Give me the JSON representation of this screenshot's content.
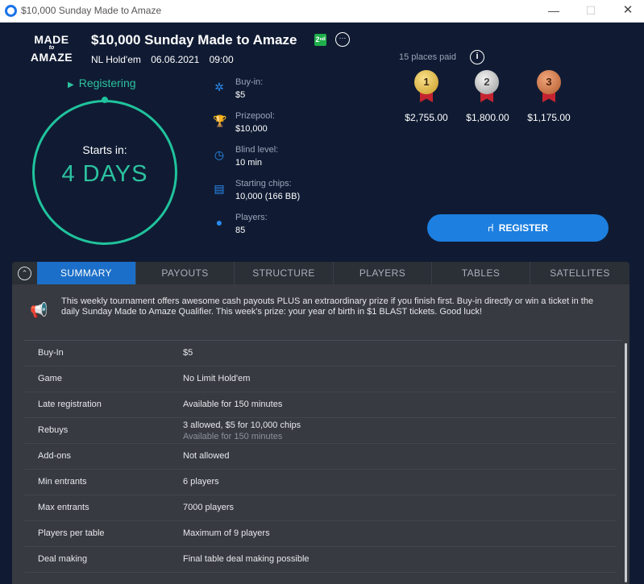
{
  "window": {
    "title": "$10,000 Sunday Made to Amaze",
    "min": "—",
    "max": "☐",
    "close": "✕"
  },
  "logo": {
    "line1": "MADE",
    "line2": "to",
    "line3": "AMAZE"
  },
  "tournament": {
    "name": "$10,000 Sunday Made to Amaze",
    "badge": "2ⁿᵈ",
    "more": "···",
    "game": "NL Hold'em",
    "date": "06.06.2021",
    "time": "09:00"
  },
  "status": {
    "arrow": "▶",
    "label": "Registering",
    "starts_label": "Starts in:",
    "starts_value": "4 DAYS"
  },
  "info": [
    {
      "icon": "poker-chip-icon",
      "glyph": "✲",
      "label": "Buy-in:",
      "value": "$5"
    },
    {
      "icon": "trophy-icon",
      "glyph": "🏆",
      "label": "Prizepool:",
      "value": "$10,000"
    },
    {
      "icon": "clock-icon",
      "glyph": "◷",
      "label": "Blind level:",
      "value": "10 min"
    },
    {
      "icon": "chips-stack-icon",
      "glyph": "▤",
      "label": "Starting chips:",
      "value": "10,000 (166 BB)"
    },
    {
      "icon": "player-icon",
      "glyph": "●",
      "label": "Players:",
      "value": "85"
    }
  ],
  "prizes": {
    "places_paid": "15 places paid",
    "info_glyph": "i",
    "items": [
      {
        "place": "1",
        "amount": "$2,755.00"
      },
      {
        "place": "2",
        "amount": "$1,800.00"
      },
      {
        "place": "3",
        "amount": "$1,175.00"
      }
    ]
  },
  "register": {
    "glyph": "⑁",
    "label": "REGISTER"
  },
  "collapse_glyph": "⌃",
  "tabs": [
    "SUMMARY",
    "PAYOUTS",
    "STRUCTURE",
    "PLAYERS",
    "TABLES",
    "SATELLITES"
  ],
  "announcement": "This weekly tournament offers awesome cash payouts PLUS an extraordinary prize if you finish first. Buy-in directly or win a ticket in the daily Sunday Made to Amaze Qualifier. This week's prize: your year of birth in $1 BLAST tickets. Good luck!",
  "summary": [
    {
      "key": "Buy-In",
      "value": "$5"
    },
    {
      "key": "Game",
      "value": "No Limit Hold'em"
    },
    {
      "key": "Late registration",
      "value": "Available for 150 minutes"
    },
    {
      "key": "Rebuys",
      "value": "3 allowed, $5 for 10,000 chips",
      "sub": "Available for 150 minutes"
    },
    {
      "key": "Add-ons",
      "value": "Not allowed"
    },
    {
      "key": "Min entrants",
      "value": "6 players"
    },
    {
      "key": "Max entrants",
      "value": "7000 players"
    },
    {
      "key": "Players per table",
      "value": "Maximum of 9 players"
    },
    {
      "key": "Deal making",
      "value": "Final table deal making possible"
    }
  ],
  "colors": {
    "background": "#101b33",
    "accent_green": "#20c39d",
    "accent_blue": "#1d7fe0",
    "panel": "#373a40"
  }
}
